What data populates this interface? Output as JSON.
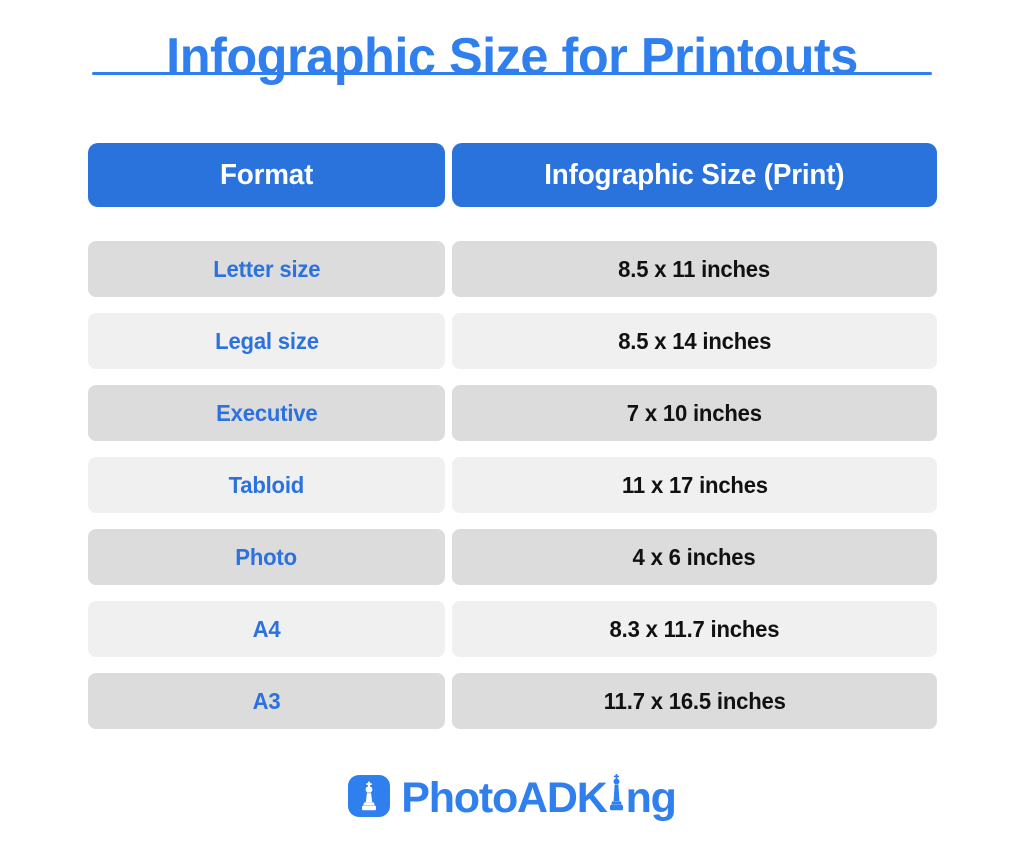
{
  "page": {
    "title": "Infographic Size for Printouts",
    "background_color": "#ffffff",
    "accent_color": "#2f7fee",
    "header_color": "#2a72dc",
    "row_dark_color": "#dcdcdc",
    "row_light_color": "#f0f0f0",
    "value_text_color": "#111111"
  },
  "table": {
    "headers": {
      "format": "Format",
      "size": "Infographic Size (Print)"
    },
    "rows": [
      {
        "format": "Letter size",
        "size": "8.5 x 11 inches",
        "shade": "dark"
      },
      {
        "format": "Legal size",
        "size": "8.5 x 14 inches",
        "shade": "light"
      },
      {
        "format": "Executive",
        "size": "7 x 10 inches",
        "shade": "dark"
      },
      {
        "format": "Tabloid",
        "size": "11 x 17 inches",
        "shade": "light"
      },
      {
        "format": "Photo",
        "size": "4 x 6 inches",
        "shade": "dark"
      },
      {
        "format": "A4",
        "size": "8.3 x 11.7 inches",
        "shade": "light"
      },
      {
        "format": "A3",
        "size": "11.7 x 16.5 inches",
        "shade": "dark"
      }
    ]
  },
  "footer": {
    "logo_icon_name": "chess-king-icon",
    "brand_part1": "PhotoADK",
    "brand_part2": "ng",
    "brand_full": "PhotoADKing"
  }
}
